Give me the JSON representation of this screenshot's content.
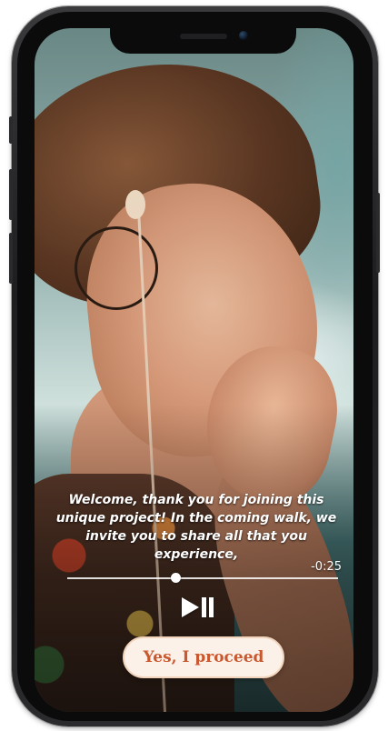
{
  "caption": {
    "lines": [
      "Welcome, thank you for joining this",
      "unique project! In the coming walk, we",
      "invite you to share all that you experience,"
    ]
  },
  "player": {
    "time_remaining": "-0:25",
    "progress_fraction": 0.4,
    "play_pause_icon": "play-pause-icon"
  },
  "actions": {
    "proceed_label": "Yes, I proceed"
  },
  "colors": {
    "accent": "#c9582f",
    "button_bg": "#fbf1e8",
    "frame": "#1d1d1f"
  }
}
